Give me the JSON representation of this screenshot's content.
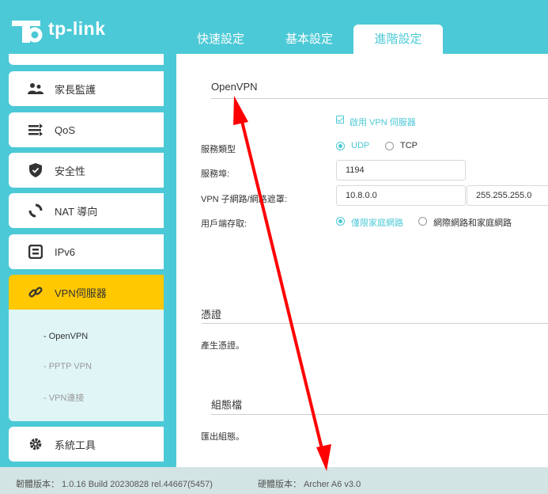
{
  "brand": {
    "name": "tp-link",
    "color": "#4cc9d6",
    "accent": "#ffc800"
  },
  "tabs": [
    {
      "label": "快速設定"
    },
    {
      "label": "基本設定"
    },
    {
      "label": "進階設定",
      "active": true
    }
  ],
  "sidebar": {
    "items": [
      {
        "label": "家長監護",
        "icon": "parental-control-icon"
      },
      {
        "label": "QoS",
        "icon": "qos-icon"
      },
      {
        "label": "安全性",
        "icon": "shield-icon"
      },
      {
        "label": "NAT 導向",
        "icon": "nat-forwarding-icon"
      },
      {
        "label": "IPv6",
        "icon": "ipv6-icon"
      },
      {
        "label": "VPN伺服器",
        "icon": "vpn-link-icon",
        "active": true
      },
      {
        "label": "系統工具",
        "icon": "gear-icon"
      }
    ],
    "submenu": [
      {
        "label": "- OpenVPN",
        "active": true
      },
      {
        "label": "- PPTP VPN"
      },
      {
        "label": "- VPN連接"
      }
    ]
  },
  "openvpn": {
    "title": "OpenVPN",
    "enable_label": "啟用 VPN 伺服器",
    "enabled": true,
    "service_type_label": "服務類型",
    "service_type_options": [
      "UDP",
      "TCP"
    ],
    "service_type_selected": "UDP",
    "port_label": "服務埠:",
    "port_value": "1194",
    "subnet_label": "VPN 子網路/網路遮罩:",
    "subnet_value": "10.8.0.0",
    "netmask_value": "255.255.255.0",
    "client_access_label": "用戶端存取:",
    "client_access_options": [
      "僅限家庭網路",
      "網際網路和家庭網路"
    ],
    "client_access_selected": "僅限家庭網路"
  },
  "certificate": {
    "title": "憑證",
    "text": "產生憑證。"
  },
  "config_file": {
    "title": "組態檔",
    "text": "匯出組態。"
  },
  "footer": {
    "firmware": "韌體版本： 1.0.16 Build 20230828 rel.44667(5457)",
    "hardware": "硬體版本： Archer A6 v3.0"
  },
  "annotation": {
    "color": "#ff0000"
  }
}
